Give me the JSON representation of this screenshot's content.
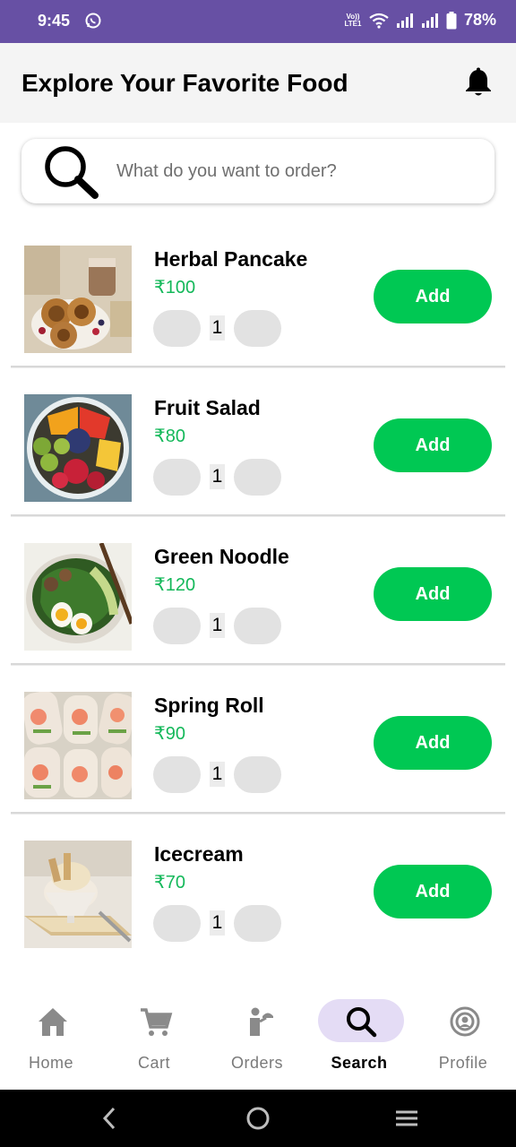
{
  "status_bar": {
    "time": "9:45",
    "lte_label": "Vo)) LTE1",
    "battery": "78%",
    "background": "#6750A4"
  },
  "header": {
    "title": "Explore Your Favorite Food",
    "bell_icon": "bell-icon"
  },
  "search": {
    "placeholder": "What do you want to order?",
    "icon": "search-icon"
  },
  "food_items": [
    {
      "name": "Herbal Pancake",
      "price": "₹100",
      "quantity": "1",
      "add_label": "Add"
    },
    {
      "name": "Fruit Salad",
      "price": "₹80",
      "quantity": "1",
      "add_label": "Add"
    },
    {
      "name": "Green Noodle",
      "price": "₹120",
      "quantity": "1",
      "add_label": "Add"
    },
    {
      "name": "Spring Roll",
      "price": "₹90",
      "quantity": "1",
      "add_label": "Add"
    },
    {
      "name": "Icecream",
      "price": "₹70",
      "quantity": "1",
      "add_label": "Add"
    }
  ],
  "bottom_nav": {
    "items": [
      {
        "label": "Home",
        "icon": "home-icon"
      },
      {
        "label": "Cart",
        "icon": "cart-icon"
      },
      {
        "label": "Orders",
        "icon": "orders-icon"
      },
      {
        "label": "Search",
        "icon": "search-icon",
        "active": true
      },
      {
        "label": "Profile",
        "icon": "profile-icon"
      }
    ]
  },
  "colors": {
    "accent_green": "#00c853",
    "price_green": "#14b85a",
    "active_pill": "#e4dcf5"
  }
}
